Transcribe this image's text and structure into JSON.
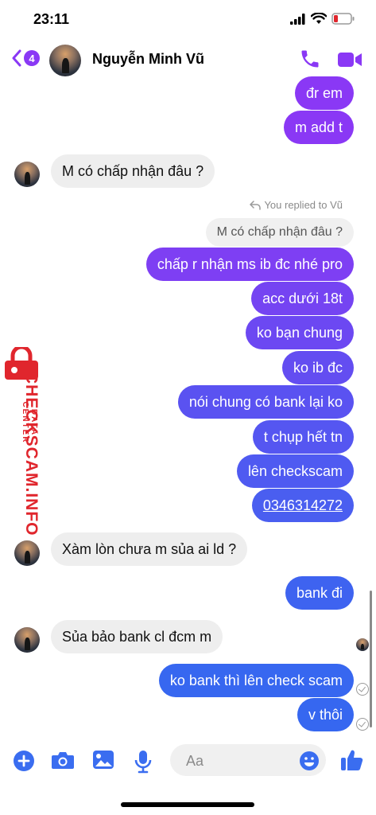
{
  "status": {
    "time": "23:11"
  },
  "header": {
    "back_count": "4",
    "contact_name": "Nguyễn Minh Vũ"
  },
  "watermark": {
    "brand": "CHECKSCAM.INFO",
    "sub": "DATA CENTER"
  },
  "replied_label": "You replied to Vũ",
  "messages": [
    {
      "text": "đr em"
    },
    {
      "text": "m add t"
    },
    {
      "text": "M có chấp nhận đâu ?"
    },
    {
      "text": "M có chấp nhận đâu ?"
    },
    {
      "text": "chấp r nhận ms ib đc nhé pro"
    },
    {
      "text": "acc dưới 18t"
    },
    {
      "text": "ko bạn chung"
    },
    {
      "text": "ko ib đc"
    },
    {
      "text": "nói chung có bank lại ko"
    },
    {
      "text": "t chụp hết tn"
    },
    {
      "text": "lên checkscam"
    },
    {
      "text": "0346314272"
    },
    {
      "text": "Xàm lòn chưa m sủa ai ld ?"
    },
    {
      "text": "bank đi"
    },
    {
      "text": "Sủa bảo bank cl đcm m"
    },
    {
      "text": "ko bank thì lên check scam"
    },
    {
      "text": "v thôi"
    }
  ],
  "composer": {
    "placeholder": "Aa"
  },
  "colors": {
    "accent": "#8a38f5",
    "outgoing_top": "#8a38f5",
    "outgoing_bottom": "#3667f0",
    "incoming": "#eeeeee"
  }
}
